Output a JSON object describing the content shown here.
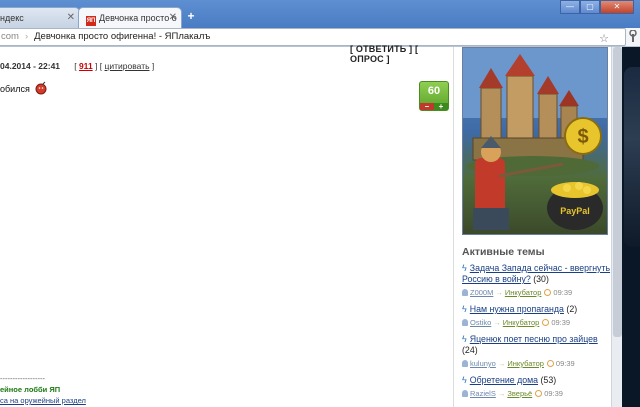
{
  "browser": {
    "tabs": [
      {
        "title": "ндекс",
        "active": false
      },
      {
        "title": "Девчонка просто офигенна! -",
        "active": true
      }
    ],
    "favicon_text": "ЯП",
    "new_tab_label": "+",
    "window_buttons": [
      "—",
      "▢",
      "✕"
    ],
    "address": {
      "domain": "com",
      "separator": "›",
      "page_title": "Девчонка просто офигенна! - ЯПлакалъ"
    }
  },
  "post": {
    "reply_buttons": "[ ОТВЕТИТЬ ] [ ОПРОС ]",
    "date": "04.2014 - 22:41",
    "post_number_open": "[",
    "post_number": "911",
    "post_number_close": "] [",
    "quote_label": "цитировать",
    "quote_close": "]",
    "body_text": "обился",
    "rating": {
      "value": "60",
      "minus": "–",
      "plus": "+"
    }
  },
  "footer": {
    "rule": "------------------",
    "line1": "ейное лобби ЯП",
    "line2": "са на оружейный раздел"
  },
  "sidebar": {
    "active_title": "Активные темы",
    "topics": [
      {
        "title": "Задача Запада сейчас - ввергнуть Россию в войну?",
        "count": "(30)",
        "user": "Z000M",
        "section": "Инкубатор",
        "time": "09:39"
      },
      {
        "title": "Нам нужна пропаганда",
        "count": "(2)",
        "user": "Ostiko",
        "section": "Инкубатор",
        "time": "09:39"
      },
      {
        "title": "Яценюк поет песню про зайцев",
        "count": "(24)",
        "user": "kulunyo",
        "section": "Инкубатор",
        "time": "09:39"
      },
      {
        "title": "Обретение дома",
        "count": "(53)",
        "user": "RazielS",
        "section": "Зверьё",
        "time": "09:39"
      }
    ]
  },
  "colors": {
    "tabstrip": "#4a7cc4",
    "link": "#1a3f86",
    "rating_green": "#5aa12a",
    "accent_red": "#c00000"
  }
}
